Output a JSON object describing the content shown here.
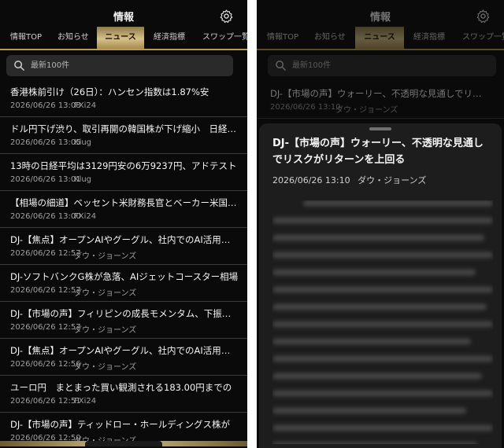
{
  "left": {
    "title": "情報",
    "tabs": [
      {
        "label": "情報TOP"
      },
      {
        "label": "お知らせ"
      },
      {
        "label": "ニュース"
      },
      {
        "label": "経済指標"
      },
      {
        "label": "スワップ一覧"
      }
    ],
    "search_placeholder": "最新100件",
    "news": [
      {
        "title": "香港株前引け（26日）：ハンセン指数は1.87%安",
        "date": "2026/06/26 13:08",
        "source": "FXi24"
      },
      {
        "title": "ドル円下げ渋り、取引再開の韓国株が下げ縮小　日経平均",
        "date": "2026/06/26 13:05",
        "source": "Klug"
      },
      {
        "title": "13時の日経平均は3129円安の6万9237円、アドテスト",
        "date": "2026/06/26 13:01",
        "source": "Klug"
      },
      {
        "title": "【相場の細道】ベッセント米財務長官とベーカー米国務長官",
        "date": "2026/06/26 13:00",
        "source": "FXi24"
      },
      {
        "title": "DJ-【焦点】オープンAIやグーグル、社内でのAI活用が進む",
        "date": "2026/06/26 12:57",
        "source": "ダウ・ジョーンズ"
      },
      {
        "title": "DJ-ソフトバンクG株が急落、AIジェットコースター相場",
        "date": "2026/06/26 12:57",
        "source": "ダウ・ジョーンズ"
      },
      {
        "title": "DJ-【市場の声】フィリピンの成長モメンタム、下振れリスク",
        "date": "2026/06/26 12:57",
        "source": "ダウ・ジョーンズ"
      },
      {
        "title": "DJ-【焦点】オープンAIやグーグル、社内でのAI活用が進む",
        "date": "2026/06/26 12:56",
        "source": "ダウ・ジョーンズ"
      },
      {
        "title": "ユーロ円　まとまった買い観測される183.00円までの",
        "date": "2026/06/26 12:51",
        "source": "FXi24"
      },
      {
        "title": "DJ-【市場の声】ティッドロー・ホールディングス株が",
        "date": "2026/06/26 12:50",
        "source": "ダウ・ジョーンズ"
      }
    ]
  },
  "right": {
    "title": "情報",
    "tabs": [
      {
        "label": "情報TOP"
      },
      {
        "label": "お知らせ"
      },
      {
        "label": "ニュース"
      },
      {
        "label": "経済指標"
      },
      {
        "label": "スワップ一覧"
      }
    ],
    "search_placeholder": "最新100件",
    "dim_news": {
      "title": "DJ-【市場の声】ウォーリー、不透明な見通しでリスクが",
      "date": "2026/06/26 13:10",
      "source": "ダウ・ジョーンズ"
    },
    "detail": {
      "title": "DJ-【市場の声】ウォーリー、不透明な見通しでリスクがリターンを上回る",
      "date": "2026/06/26 13:10",
      "source": "ダウ・ジョーンズ"
    }
  },
  "colors": {
    "accent_gold": "#d6c08a",
    "background": "#0a0a0a",
    "sheet": "#1d1d1d"
  }
}
